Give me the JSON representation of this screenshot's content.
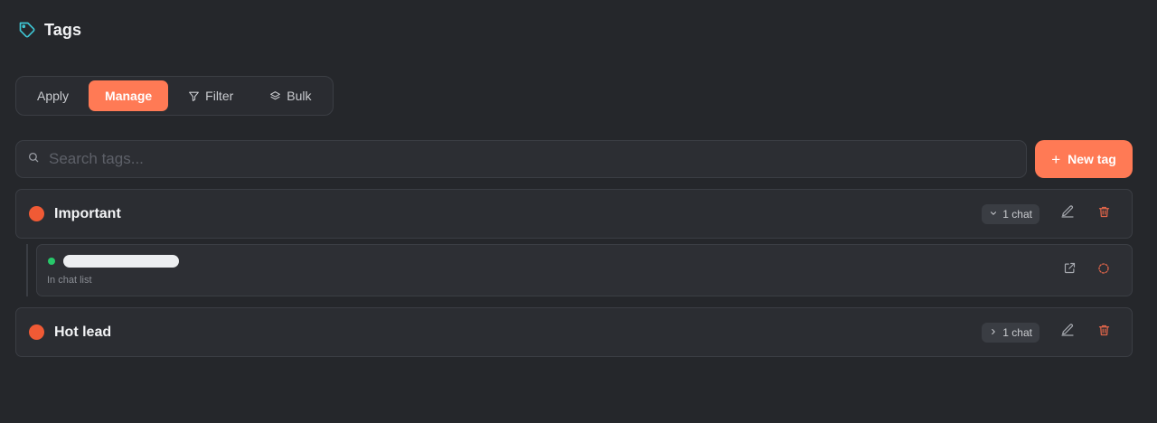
{
  "header": {
    "title": "Tags",
    "icon": "tag-icon"
  },
  "tabs": [
    {
      "label": "Apply",
      "active": false
    },
    {
      "label": "Manage",
      "active": true
    },
    {
      "label": "Filter",
      "icon": "filter-icon",
      "active": false
    },
    {
      "label": "Bulk",
      "icon": "layers-icon",
      "active": false
    }
  ],
  "search": {
    "placeholder": "Search tags...",
    "value": ""
  },
  "new_tag_button": {
    "label": "New tag"
  },
  "tags": [
    {
      "name": "Important",
      "color": "#f05a35",
      "count_label": "1 chat",
      "expanded": true,
      "chats": [
        {
          "status_color": "#27c86a",
          "subtitle": "In chat list"
        }
      ]
    },
    {
      "name": "Hot lead",
      "color": "#f05a35",
      "count_label": "1 chat",
      "expanded": false,
      "chats": []
    }
  ],
  "colors": {
    "accent": "#ff7a55",
    "background": "#25272b",
    "tag_dot": "#f05a35",
    "online": "#27c86a",
    "delete": "#e0654a"
  }
}
